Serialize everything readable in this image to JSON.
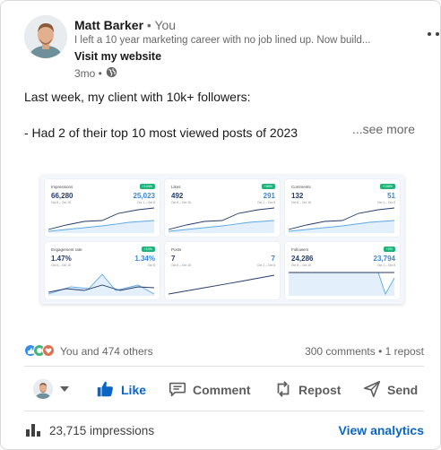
{
  "post": {
    "author_name": "Matt Barker",
    "author_suffix": " • You",
    "headline": "I left a 10 year marketing career with no job lined up. Now build...",
    "website_link": "Visit my website",
    "time_ago": "3mo •",
    "visibility_icon": "globe-icon",
    "text_line1": "Last week, my client with 10k+ followers:",
    "text_line2": "- Had 2 of their top 10 most viewed posts of 2023",
    "see_more": "...see more"
  },
  "dashboard": {
    "tiles": [
      {
        "label": "Impressions",
        "badge": "+134%",
        "current": "66,280",
        "previous": "25,023",
        "period_current": "Oct 8 – Oct 15",
        "period_previous": "Oct 1 – Oct 8",
        "chart_style": "growth"
      },
      {
        "label": "Likes",
        "badge": "+69%",
        "current": "492",
        "previous": "291",
        "period_current": "Oct 8 – Oct 15",
        "period_previous": "Oct 1 – Oct 8",
        "chart_style": "growth"
      },
      {
        "label": "Comments",
        "badge": "+158%",
        "current": "132",
        "previous": "51",
        "period_current": "Oct 8 – Oct 15",
        "period_previous": "Oct 1 – Oct 8",
        "chart_style": "growth"
      },
      {
        "label": "Engagement rate",
        "badge": "+10%",
        "current": "1.47%",
        "previous": "1.34%",
        "period_current": "Oct 8 – Oct 15",
        "period_previous": "Oct 8",
        "chart_style": "wave"
      },
      {
        "label": "Posts",
        "badge": "",
        "current": "7",
        "previous": "7",
        "period_current": "Oct 8 – Oct 15",
        "period_previous": "Oct 1 – Oct 8",
        "chart_style": "linear"
      },
      {
        "label": "Followers",
        "badge": "+2%",
        "current": "24,286",
        "previous": "23,794",
        "period_current": "Oct 8 – Oct 15",
        "period_previous": "Oct 1 – Oct 8",
        "chart_style": "step"
      }
    ]
  },
  "social": {
    "reactions_label": "You and 474 others",
    "comments_reposts": "300 comments • 1 repost"
  },
  "actions": {
    "like": "Like",
    "comment": "Comment",
    "repost": "Repost",
    "send": "Send"
  },
  "footer": {
    "impressions": "23,715 impressions",
    "view_analytics": "View analytics"
  },
  "colors": {
    "accent": "#0a66c2",
    "badge_green": "#1fb27a",
    "chart_dark": "#243b6b",
    "chart_light": "#5aa9e6"
  }
}
